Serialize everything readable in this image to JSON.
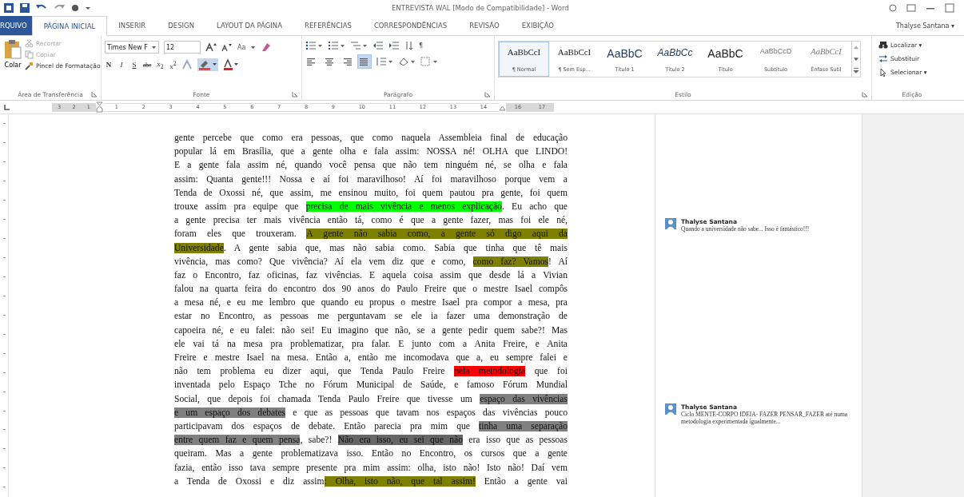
{
  "window": {
    "title": "ENTREVISTA WAL [Modo de Compatibilidade] - Word"
  },
  "user": {
    "name": "Thalyse Santana ▾"
  },
  "tabs": [
    {
      "label": "RQUIVO",
      "kind": "file",
      "selected": false
    },
    {
      "label": "PÁGINA INICIAL",
      "kind": "tab",
      "selected": true
    },
    {
      "label": "INSERIR",
      "kind": "tab",
      "selected": false
    },
    {
      "label": "DESIGN",
      "kind": "tab",
      "selected": false
    },
    {
      "label": "LAYOUT DA PÁGINA",
      "kind": "tab",
      "selected": false
    },
    {
      "label": "REFERÊNCIAS",
      "kind": "tab",
      "selected": false
    },
    {
      "label": "CORRESPONDÊNCIAS",
      "kind": "tab",
      "selected": false
    },
    {
      "label": "REVISÃO",
      "kind": "tab",
      "selected": false
    },
    {
      "label": "EXIBIÇÃO",
      "kind": "tab",
      "selected": false
    }
  ],
  "clipboard": {
    "label": "Área de Transferência",
    "paste": "Colar",
    "items": [
      {
        "label": "Recortar",
        "disabled": true
      },
      {
        "label": "Copiar",
        "disabled": true
      },
      {
        "label": "Pincel de Formatação",
        "disabled": false
      }
    ]
  },
  "font": {
    "label": "Fonte",
    "family": "Times New F",
    "size": "12",
    "case_button": "Aa",
    "format_buttons": [
      "N",
      "I",
      "S",
      "abc",
      "x$_{2}$",
      "x$^{2}$"
    ]
  },
  "paragraph": {
    "label": "Parágrafo",
    "pilcrow": "¶",
    "alignments": [
      {
        "kind": "left",
        "selected": false
      },
      {
        "kind": "center",
        "selected": false
      },
      {
        "kind": "right",
        "selected": false
      },
      {
        "kind": "justify",
        "selected": true
      }
    ]
  },
  "styles": {
    "label": "Estilo",
    "items": [
      {
        "sample": "AaBbCcI",
        "name": "¶ Normal",
        "kind": "body",
        "selected": true
      },
      {
        "sample": "AaBbCcI",
        "name": "¶ Sem Esp...",
        "kind": "body",
        "selected": false
      },
      {
        "sample": "AaBbC",
        "name": "Título 1",
        "kind": "heading1",
        "selected": false
      },
      {
        "sample": "AaBbCc",
        "name": "Título 2",
        "kind": "heading2",
        "selected": false
      },
      {
        "sample": "AaBbC",
        "name": "Título",
        "kind": "title",
        "selected": false
      },
      {
        "sample": "AaBbCcD",
        "name": "Subtítulo",
        "kind": "subtitle",
        "selected": false
      },
      {
        "sample": "AaBbCcI",
        "name": "Ênfase Sutil",
        "kind": "emphasis",
        "selected": false
      }
    ]
  },
  "editing": {
    "label": "Edição",
    "items": [
      {
        "label": "Localizar ▾",
        "kind": "find"
      },
      {
        "label": "Substituir",
        "kind": "replace"
      },
      {
        "label": "Selecionar ▾",
        "kind": "select"
      }
    ]
  },
  "ruler": {
    "left_marks": [
      "3",
      "2",
      "1"
    ],
    "marks": [
      "1",
      "2",
      "3",
      "4",
      "5",
      "6",
      "7",
      "8",
      "9",
      "10",
      "11",
      "12",
      "13",
      "14"
    ],
    "right_marks": [
      "16",
      "17"
    ]
  },
  "document": {
    "lines": [
      [
        {
          "text": "gente percebe que como era pessoas, que como naquela Assembleia final de educação"
        }
      ],
      [
        {
          "text": "popular lá em Brasília, que a gente olha e fala assim: NOSSA né! OLHA que LINDO!"
        }
      ],
      [
        {
          "text": "E a gente fala assim né, quando você pensa que não tem ninguém né, se olha e fala"
        }
      ],
      [
        {
          "text": "assim: Quanta gente!!! Nossa e aí foi maravilhoso! Aí foi maravilhoso porque vem a"
        }
      ],
      [
        {
          "text": "Tenda de Oxossi né, que assim, me ensinou muito, foi quem pautou pra gente, foi quem"
        }
      ],
      [
        {
          "text": "trouxe assim pra equipe que "
        },
        {
          "text": "precisa de mais vivência e menos explicação",
          "color": "#00ff00"
        },
        {
          "text": ". Eu acho que"
        }
      ],
      [
        {
          "text": "a gente precisa ter mais vivência então tá, como é que a gente fazer, mas foi ele né,"
        }
      ],
      [
        {
          "text": "foram eles que trouxeram. "
        },
        {
          "text": "A gente não sabia como, a gente só digo aqui da",
          "color": "#808000"
        }
      ],
      [
        {
          "text": "Universidade",
          "color": "#808000"
        },
        {
          "text": ". A gente sabia que, mas não sabia como. Sabia que tinha que tê mais"
        }
      ],
      [
        {
          "text": "vivência, mas como? Que vivência? Aí ela vem diz que e como, "
        },
        {
          "text": "como faz? Vamos",
          "color": "#808000"
        },
        {
          "text": "! Aí"
        }
      ],
      [
        {
          "text": "faz o Encontro, faz oficinas, faz vivências. E aquela coisa assim que desde lá a Vivian"
        }
      ],
      [
        {
          "text": "falou na quarta feira do encontro dos 90 anos do Paulo Freire que o mestre Isael compôs"
        }
      ],
      [
        {
          "text": "a mesa né, e eu me lembro que quando eu propus o mestre Isael pra compor a mesa, pra"
        }
      ],
      [
        {
          "text": "estar no Encontro, as pessoas me perguntavam se ele ia fazer uma demonstração de"
        }
      ],
      [
        {
          "text": "capoeira né, e eu falei: não sei! Eu imagino que não, se a gente pedir quem sabe?! Mas"
        }
      ],
      [
        {
          "text": "ele vai tá na mesa pra problematizar, pra falar. E junto com a Anita Freire, e Anita"
        }
      ],
      [
        {
          "text": "Freire e mestre Isael na mesa. Então a, então me incomodava que a, eu sempre falei e"
        }
      ],
      [
        {
          "text": "não tem problema eu dizer aqui, que Tenda Paulo Freire "
        },
        {
          "text": "pela metodologia",
          "color": "#ff0000"
        },
        {
          "text": " que foi"
        }
      ],
      [
        {
          "text": "inventada pelo Espaço Tche no Fórum Municipal de Saúde, e famoso Fórum Mundial"
        }
      ],
      [
        {
          "text": "Social, que depois foi chamada Tenda Paulo Freire que tivesse um "
        },
        {
          "text": "espaço das vivências",
          "color": "#808080"
        }
      ],
      [
        {
          "text": "e um espaço dos debates",
          "color": "#808080"
        },
        {
          "text": " e que as pessoas que tavam nos espaços das vivências pouco"
        }
      ],
      [
        {
          "text": "participavam dos espaços de debate. Então parecia pra mim que "
        },
        {
          "text": "tinha uma separação",
          "color": "#808080"
        }
      ],
      [
        {
          "text": "entre quem faz e quem pensa",
          "color": "#808080"
        },
        {
          "text": ", sabe?! "
        },
        {
          "text": "Não era isso, eu sei que não",
          "color": "#666666"
        },
        {
          "text": " era isso que as pessoas"
        }
      ],
      [
        {
          "text": "queiram. Mas a gente problematizava isso. Então no Encontro, os cursos que a gente"
        }
      ],
      [
        {
          "text": "fazia, então isso tava sempre presente pra mim assim: olha, isto não! Isto não! Daí vem"
        }
      ],
      [
        {
          "text": "a Tenda de Oxossi e diz assim"
        },
        {
          "text": ": Olha, isto não, que tal assim!",
          "color": "#808000"
        },
        {
          "text": " Então a gente vai"
        }
      ]
    ]
  },
  "comments": [
    {
      "author": "Thalyse Santana",
      "text": "Quando a universidade não sabe... Isso é fantástico!!!"
    },
    {
      "author": "Thalyse Santana",
      "text": "Ciclo MENTE-CORPO IDEIA- FAZER PENSAR_FAZER até numa metodologia experimentada igualmente..."
    }
  ]
}
